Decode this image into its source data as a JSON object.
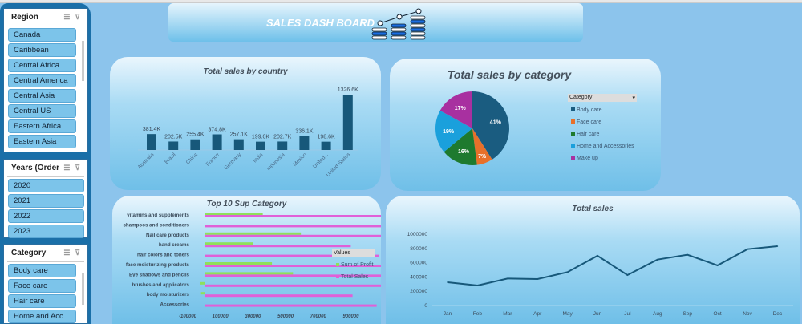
{
  "header": {
    "title": "SALES DASH BOARD",
    "icon": "bar-chart-growth-icon"
  },
  "slicers": {
    "region": {
      "title": "Region",
      "items": [
        "Canada",
        "Caribbean",
        "Central Africa",
        "Central America",
        "Central Asia",
        "Central US",
        "Eastern Africa",
        "Eastern Asia"
      ]
    },
    "years": {
      "title": "Years (Order...",
      "items": [
        "2020",
        "2021",
        "2022",
        "2023"
      ]
    },
    "category": {
      "title": "Category",
      "items": [
        "Body care",
        "Face care",
        "Hair care",
        "Home and Acc..."
      ]
    }
  },
  "chart_data": [
    {
      "type": "bar",
      "title": "Total sales by country",
      "categories": [
        "Australia",
        "Brazil",
        "China",
        "France",
        "Germany",
        "India",
        "Indonesia",
        "Mexico",
        "United...",
        "United States"
      ],
      "values": [
        381.4,
        202.5,
        255.4,
        374.8,
        257.1,
        199.0,
        202.7,
        336.1,
        198.6,
        1326.6
      ],
      "labels": [
        "381.4K",
        "202.5K",
        "255.4K",
        "374.8K",
        "257.1K",
        "199.0K",
        "202.7K",
        "336.1K",
        "198.6K",
        "1326.6K"
      ],
      "unit": "K",
      "color": "#17587a"
    },
    {
      "type": "pie",
      "title": "Total sales by category",
      "legend_title": "Category",
      "categories": [
        "Body care",
        "Face care",
        "Hair care",
        "Home and Accessories",
        "Make up"
      ],
      "values": [
        41,
        7,
        16,
        19,
        17
      ],
      "labels": [
        "41%",
        "7%",
        "16%",
        "19%",
        "17%"
      ],
      "colors": [
        "#1a5c80",
        "#e8702a",
        "#1e7a2e",
        "#1aa0dc",
        "#a830a0"
      ]
    },
    {
      "type": "bar",
      "orientation": "horizontal",
      "title": "Top 10 Sup Category",
      "legend_title": "Values",
      "categories": [
        "vitamins and supplements",
        "shampoos and conditioners",
        "Nail care products",
        "hand creams",
        "hair colors and toners",
        "face moisturizing products",
        "Eye shadows and pencils",
        "brushes and applicators",
        "body moisturizers",
        "Accessories"
      ],
      "series": [
        {
          "name": "Sum of Profit",
          "color": "#8ee05a",
          "values": [
            133000,
            0,
            220000,
            111000,
            0,
            154000,
            202000,
            -10000,
            -8000,
            0
          ]
        },
        {
          "name": "Total Sales",
          "color": "#e060d8",
          "values": [
            444000,
            616000,
            783000,
            334000,
            398000,
            444000,
            605000,
            444000,
            338000,
            393000
          ]
        }
      ],
      "xticks": [
        "-100000",
        "100000",
        "300000",
        "500000",
        "700000",
        "900000"
      ],
      "xlim": [
        -100000,
        900000
      ]
    },
    {
      "type": "line",
      "title": "Total sales",
      "categories": [
        "Jan",
        "Feb",
        "Mar",
        "Apr",
        "May",
        "Jun",
        "Jul",
        "Aug",
        "Sep",
        "Oct",
        "Nov",
        "Dec"
      ],
      "values": [
        326000,
        281000,
        378000,
        371000,
        468000,
        697000,
        427000,
        644000,
        712000,
        562000,
        790000,
        831000
      ],
      "yticks": [
        "0",
        "200000",
        "400000",
        "600000",
        "800000",
        "1000000"
      ],
      "ylim": [
        0,
        1000000
      ],
      "color": "#17587a"
    }
  ]
}
